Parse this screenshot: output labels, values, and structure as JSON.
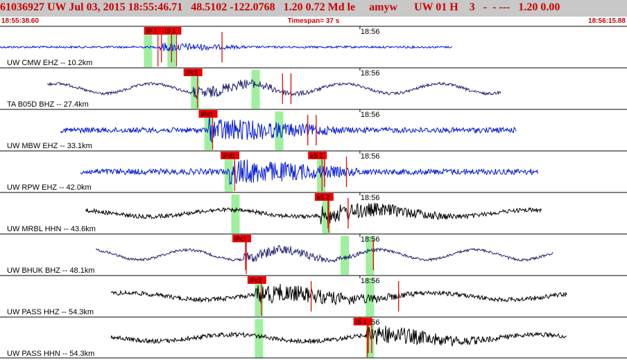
{
  "header": {
    "title": "61036927 UW Jul 03, 2015 18:55:46.71   48.5102 -122.0768   1.20 0.72 Md le     amyw      UW 01 H    3   -  - ---   1.20 0.00",
    "start_time": "18:55:38.60",
    "timespan": "Timespan=  37 s",
    "end_time": "18:56:15.88"
  },
  "colors": {
    "header_bg": "#c8c8c8",
    "title": "#cc0000",
    "pick_box": "#ee0000",
    "window": "#9ef09e",
    "blue": "#0018d8",
    "navy": "#202070",
    "black": "#000000"
  },
  "chart_data": {
    "type": "line",
    "title": "",
    "xlabel": "",
    "ylabel": "",
    "xlim_seconds": [
      0,
      37.28
    ],
    "time_tick": "18:56",
    "traces": [
      {
        "label": "UW CMW EHZ -- 10.2km",
        "color": "blue",
        "data_window": [
          0,
          26.9
        ],
        "color_key": "blue",
        "picks": [
          {
            "tag": "IP 1",
            "t": 8.65
          },
          {
            "tag": "IS 1",
            "t": 9.75
          }
        ],
        "windows": [
          8.8,
          10.2
        ],
        "sticks": [
          9.6,
          10.2,
          13.2
        ],
        "burst": [
          9.5,
          15.0
        ],
        "amp": 0.16
      },
      {
        "label": "TA B05D BHZ -- 27.4km",
        "color": "navy",
        "data_window": [
          2.8,
          29.8
        ],
        "picks": [
          {
            "tag": "iPc1",
            "t": 11.0
          }
        ],
        "windows": [
          11.6,
          15.2
        ],
        "sticks": [
          16.8,
          17.3
        ],
        "burst": [
          11.5,
          19.5
        ],
        "amp": 0.28
      },
      {
        "label": "UW MBW EHZ -- 33.1km",
        "color": "blue",
        "data_window": [
          3.6,
          30.7
        ],
        "picks": [
          {
            "tag": "iPd1",
            "t": 11.9
          }
        ],
        "windows": [
          12.4,
          16.6
        ],
        "sticks": [
          18.3,
          18.8
        ],
        "burst": [
          12.4,
          21.0
        ],
        "amp": 0.42
      },
      {
        "label": "UW RPW EHZ -- 42.0km",
        "color": "blue",
        "data_window": [
          4.8,
          32.0
        ],
        "picks": [
          {
            "tag": "iPd1",
            "t": 13.2
          },
          {
            "tag": "eS 2",
            "t": 18.4
          }
        ],
        "windows": [
          13.6,
          19.1
        ],
        "sticks": [
          19.3,
          20.6
        ],
        "burst": [
          13.6,
          22.0
        ],
        "amp": 0.45
      },
      {
        "label": "UW MRBL HHN -- 43.6km",
        "color": "black",
        "data_window": [
          5.1,
          32.2
        ],
        "picks": [
          {
            "tag": "eS 2",
            "t": 18.8
          }
        ],
        "windows": [
          14.0,
          19.4
        ],
        "sticks": [
          19.5,
          20.7
        ],
        "burst": [
          19.0,
          28.0
        ],
        "amp": 0.32
      },
      {
        "label": "UW BHUK BHZ -- 48.1km",
        "color": "navy",
        "data_window": [
          5.7,
          32.9
        ],
        "picks": [
          {
            "tag": "iPc1",
            "t": 13.9
          }
        ],
        "windows": [
          20.5,
          22.0
        ],
        "sticks": [
          14.6,
          22.2
        ],
        "burst": [
          14.5,
          23.0
        ],
        "amp": 0.25
      },
      {
        "label": "UW PASS HHZ -- 54.3km",
        "color": "black",
        "data_window": [
          6.6,
          33.7
        ],
        "picks": [
          {
            "tag": "iPc2",
            "t": 14.8
          }
        ],
        "windows": [
          15.4,
          22.0
        ],
        "sticks": [
          18.5,
          23.7
        ],
        "burst": [
          15.2,
          25.0
        ],
        "amp": 0.34
      },
      {
        "label": "UW PASS HHN -- 54.3km",
        "color": "black",
        "data_window": [
          6.6,
          33.7
        ],
        "picks": [
          {
            "tag": "IS 1",
            "t": 21.1
          }
        ],
        "windows": [
          15.4,
          22.0
        ],
        "sticks": [
          21.9,
          22.1
        ],
        "burst": [
          21.8,
          30.0
        ],
        "amp": 0.34
      }
    ]
  }
}
